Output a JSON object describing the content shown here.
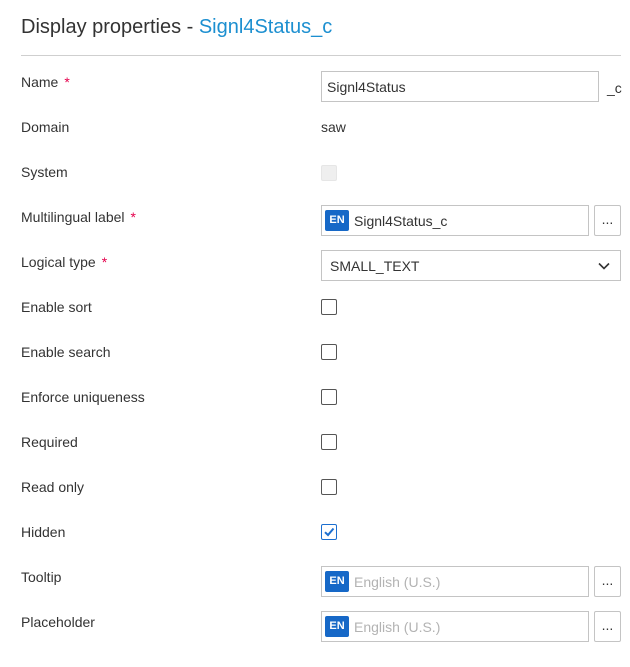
{
  "header": {
    "title_prefix": "Display properties - ",
    "entity_name": "Signl4Status_c"
  },
  "fields": {
    "name": {
      "label": "Name",
      "required_mark": "*",
      "value": "Signl4Status",
      "suffix": "_c"
    },
    "domain": {
      "label": "Domain",
      "value": "saw"
    },
    "system": {
      "label": "System",
      "checked": false,
      "disabled": true
    },
    "multilingual_label": {
      "label": "Multilingual label",
      "required_mark": "*",
      "lang": "EN",
      "value": "Signl4Status_c",
      "button": "..."
    },
    "logical_type": {
      "label": "Logical type",
      "required_mark": "*",
      "value": "SMALL_TEXT"
    },
    "enable_sort": {
      "label": "Enable sort",
      "checked": false
    },
    "enable_search": {
      "label": "Enable search",
      "checked": false
    },
    "enforce_uniqueness": {
      "label": "Enforce uniqueness",
      "checked": false
    },
    "required": {
      "label": "Required",
      "checked": false
    },
    "read_only": {
      "label": "Read only",
      "checked": false
    },
    "hidden": {
      "label": "Hidden",
      "checked": true
    },
    "tooltip": {
      "label": "Tooltip",
      "lang": "EN",
      "placeholder": "English (U.S.)",
      "button": "..."
    },
    "placeholder": {
      "label": "Placeholder",
      "lang": "EN",
      "placeholder": "English (U.S.)",
      "button": "..."
    }
  },
  "colors": {
    "accent": "#1c8fd0",
    "required": "#e5004c",
    "lang_badge": "#1668c7"
  }
}
